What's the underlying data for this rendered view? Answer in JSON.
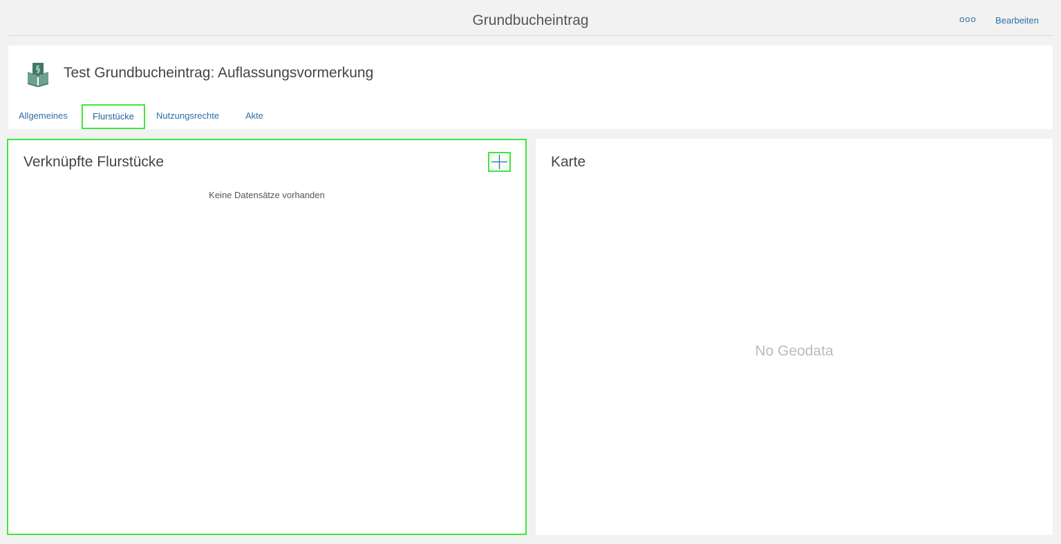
{
  "topbar": {
    "title": "Grundbucheintrag",
    "more_label": "ooo",
    "edit_label": "Bearbeiten"
  },
  "header": {
    "icon": "law-book-icon",
    "title": "Test Grundbucheintrag: Auflassungsvormerkung"
  },
  "tabs": [
    {
      "label": "Allgemeines",
      "active": false
    },
    {
      "label": "Flurstücke",
      "active": true
    },
    {
      "label": "Nutzungsrechte",
      "active": false
    },
    {
      "label": "Akte",
      "active": false
    }
  ],
  "left_panel": {
    "title": "Verknüpfte Flurstücke",
    "add_icon": "plus-icon",
    "empty_message": "Keine Datensätze vorhanden"
  },
  "right_panel": {
    "title": "Karte",
    "placeholder": "No Geodata"
  },
  "colors": {
    "accent": "#2e6da4",
    "highlight": "#3ee63e",
    "icon_green": "#3f7a65"
  }
}
